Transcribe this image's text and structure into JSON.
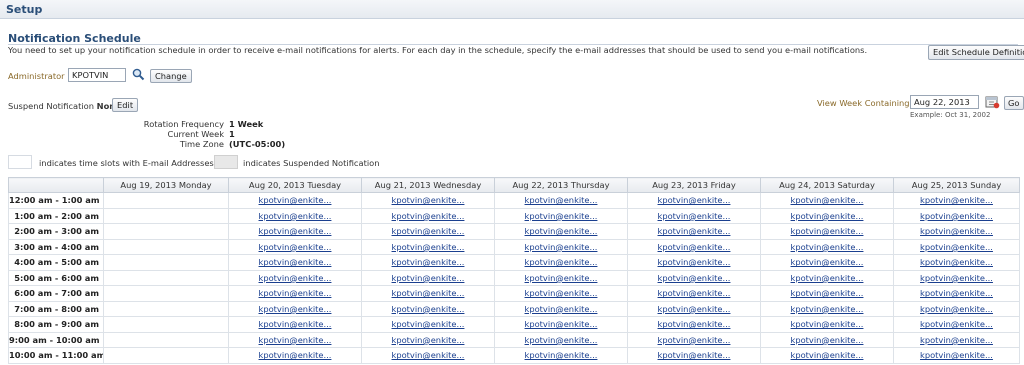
{
  "header": {
    "title": "Setup"
  },
  "schedule": {
    "title": "Notification Schedule",
    "intro": "You need to set up your notification schedule in order to receive e-mail notifications for alerts. For each day in the schedule, specify the e-mail addresses that should be used to send you e-mail notifications.",
    "edit_definition_label": "Edit Schedule Definition",
    "administrator_label": "Administrator",
    "administrator_value": "KPOTVIN",
    "change_label": "Change",
    "suspend_label": "Suspend Notification",
    "suspend_value": "None",
    "edit_label": "Edit",
    "view_week_label": "View Week Containing",
    "view_week_value": "Aug 22, 2013",
    "go_label": "Go",
    "example_text": "Example: Oct 31, 2002",
    "rotation_label": "Rotation Frequency",
    "rotation_value": "1 Week",
    "current_week_label": "Current Week",
    "current_week_value": "1",
    "timezone_label": "Time Zone",
    "timezone_value": "(UTC-05:00)",
    "legend_email": "indicates time slots with E-mail Addresses",
    "legend_suspended": "indicates Suspended Notification",
    "icons": {
      "search": "magnifier-icon",
      "calendar": "calendar-icon"
    }
  },
  "table": {
    "columns": [
      "",
      "Aug 19, 2013 Monday",
      "Aug 20, 2013 Tuesday",
      "Aug 21, 2013 Wednesday",
      "Aug 22, 2013 Thursday",
      "Aug 23, 2013 Friday",
      "Aug 24, 2013 Saturday",
      "Aug 25, 2013 Sunday"
    ],
    "rows": [
      {
        "time": "12:00 am - 1:00 am",
        "cells": [
          "",
          "kpotvin@enkite...",
          "kpotvin@enkite...",
          "kpotvin@enkite...",
          "kpotvin@enkite...",
          "kpotvin@enkite...",
          "kpotvin@enkite..."
        ]
      },
      {
        "time": "1:00 am - 2:00 am",
        "cells": [
          "",
          "kpotvin@enkite...",
          "kpotvin@enkite...",
          "kpotvin@enkite...",
          "kpotvin@enkite...",
          "kpotvin@enkite...",
          "kpotvin@enkite..."
        ]
      },
      {
        "time": "2:00 am - 3:00 am",
        "cells": [
          "",
          "kpotvin@enkite...",
          "kpotvin@enkite...",
          "kpotvin@enkite...",
          "kpotvin@enkite...",
          "kpotvin@enkite...",
          "kpotvin@enkite..."
        ]
      },
      {
        "time": "3:00 am - 4:00 am",
        "cells": [
          "",
          "kpotvin@enkite...",
          "kpotvin@enkite...",
          "kpotvin@enkite...",
          "kpotvin@enkite...",
          "kpotvin@enkite...",
          "kpotvin@enkite..."
        ]
      },
      {
        "time": "4:00 am - 5:00 am",
        "cells": [
          "",
          "kpotvin@enkite...",
          "kpotvin@enkite...",
          "kpotvin@enkite...",
          "kpotvin@enkite...",
          "kpotvin@enkite...",
          "kpotvin@enkite..."
        ]
      },
      {
        "time": "5:00 am - 6:00 am",
        "cells": [
          "",
          "kpotvin@enkite...",
          "kpotvin@enkite...",
          "kpotvin@enkite...",
          "kpotvin@enkite...",
          "kpotvin@enkite...",
          "kpotvin@enkite..."
        ]
      },
      {
        "time": "6:00 am - 7:00 am",
        "cells": [
          "",
          "kpotvin@enkite...",
          "kpotvin@enkite...",
          "kpotvin@enkite...",
          "kpotvin@enkite...",
          "kpotvin@enkite...",
          "kpotvin@enkite..."
        ]
      },
      {
        "time": "7:00 am - 8:00 am",
        "cells": [
          "",
          "kpotvin@enkite...",
          "kpotvin@enkite...",
          "kpotvin@enkite...",
          "kpotvin@enkite...",
          "kpotvin@enkite...",
          "kpotvin@enkite..."
        ]
      },
      {
        "time": "8:00 am - 9:00 am",
        "cells": [
          "",
          "kpotvin@enkite...",
          "kpotvin@enkite...",
          "kpotvin@enkite...",
          "kpotvin@enkite...",
          "kpotvin@enkite...",
          "kpotvin@enkite..."
        ]
      },
      {
        "time": "9:00 am - 10:00 am",
        "cells": [
          "",
          "kpotvin@enkite...",
          "kpotvin@enkite...",
          "kpotvin@enkite...",
          "kpotvin@enkite...",
          "kpotvin@enkite...",
          "kpotvin@enkite..."
        ]
      },
      {
        "time": "10:00 am - 11:00 am",
        "cells": [
          "",
          "kpotvin@enkite...",
          "kpotvin@enkite...",
          "kpotvin@enkite...",
          "kpotvin@enkite...",
          "kpotvin@enkite...",
          "kpotvin@enkite..."
        ]
      }
    ]
  }
}
